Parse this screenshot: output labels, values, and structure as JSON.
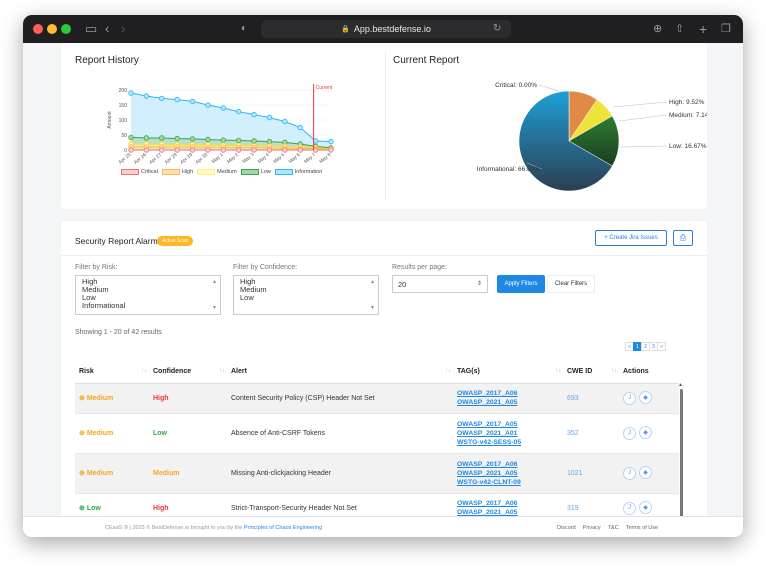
{
  "browser": {
    "url": "App.bestdefense.io"
  },
  "report_history": {
    "title": "Report History",
    "current_label": "Current",
    "legend": [
      "Critical",
      "High",
      "Medium",
      "Low",
      "Information"
    ]
  },
  "current_report": {
    "title": "Current Report",
    "labels": {
      "critical": "Critical: 0.00%",
      "high": "High: 9.52%",
      "medium": "Medium: 7.14%",
      "low": "Low: 16.67%",
      "informational": "Informational: 66.67%"
    }
  },
  "chart_data": [
    {
      "type": "area",
      "title": "Report History",
      "ylabel": "Amount",
      "ylim": [
        0,
        200
      ],
      "yticks": [
        0,
        50,
        100,
        150,
        200
      ],
      "categories": [
        "Apr 25",
        "Apr 26",
        "Apr 27",
        "Apr 28",
        "Apr 29",
        "Apr 30",
        "May 1",
        "May 2",
        "May 3",
        "May 4",
        "May 5",
        "May 6",
        "May 7",
        "May 8"
      ],
      "series": [
        {
          "name": "Critical",
          "values": [
            0,
            0,
            0,
            0,
            0,
            0,
            0,
            0,
            0,
            0,
            0,
            0,
            0,
            0
          ]
        },
        {
          "name": "High",
          "values": [
            10,
            10,
            10,
            10,
            10,
            9,
            9,
            8,
            8,
            7,
            6,
            5,
            4,
            4
          ]
        },
        {
          "name": "Medium",
          "values": [
            20,
            19,
            19,
            18,
            18,
            17,
            16,
            15,
            14,
            13,
            12,
            10,
            8,
            3
          ]
        },
        {
          "name": "Low",
          "values": [
            42,
            40,
            40,
            38,
            37,
            35,
            33,
            32,
            30,
            28,
            25,
            20,
            12,
            7
          ]
        },
        {
          "name": "Information",
          "values": [
            190,
            180,
            172,
            168,
            162,
            150,
            140,
            128,
            118,
            108,
            95,
            75,
            30,
            28
          ]
        }
      ],
      "annotation": "Current"
    },
    {
      "type": "pie",
      "title": "Current Report",
      "categories": [
        "Critical",
        "High",
        "Medium",
        "Low",
        "Informational"
      ],
      "values": [
        0.0,
        9.52,
        7.14,
        16.67,
        66.67
      ]
    }
  ],
  "alarms": {
    "title": "Security Report Alarms",
    "badge": "Active Scan",
    "create_jira": "+ Create Jira Issues",
    "print_icon": "printer-icon"
  },
  "filters": {
    "risk_label": "Filter by Risk:",
    "risk_options": [
      "High",
      "Medium",
      "Low",
      "Informational"
    ],
    "confidence_label": "Filter by Confidence:",
    "confidence_options": [
      "High",
      "Medium",
      "Low"
    ],
    "results_label": "Results per page:",
    "results_value": "20",
    "apply": "Apply Filters",
    "clear": "Clear Filters"
  },
  "results_summary": "Showing 1 - 20 of 42 results",
  "pagination": [
    "«",
    "1",
    "2",
    "3",
    "»"
  ],
  "table": {
    "headers": [
      "Risk",
      "Confidence",
      "Alert",
      "TAG(s)",
      "CWE ID",
      "Actions"
    ],
    "rows": [
      {
        "risk": "Medium",
        "confidence": "High",
        "alert": "Content Security Policy (CSP) Header Not Set",
        "tags": [
          "OWASP_2017_A06",
          "OWASP_2021_A05"
        ],
        "cwe": "693"
      },
      {
        "risk": "Medium",
        "confidence": "Low",
        "alert": "Absence of Anti-CSRF Tokens",
        "tags": [
          "OWASP_2017_A05",
          "OWASP_2021_A01",
          "WSTG-v42-SESS-05"
        ],
        "cwe": "352"
      },
      {
        "risk": "Medium",
        "confidence": "Medium",
        "alert": "Missing Anti-clickjacking Header",
        "tags": [
          "OWASP_2017_A06",
          "OWASP_2021_A05",
          "WSTG-v42-CLNT-09"
        ],
        "cwe": "1021"
      },
      {
        "risk": "Low",
        "confidence": "High",
        "alert": "Strict-Transport-Security Header Not Set",
        "tags": [
          "OWASP_2017_A06",
          "OWASP_2021_A05"
        ],
        "cwe": "319"
      }
    ]
  },
  "footer": {
    "copyright": "CEaaS ® | 2023 © BestDefense.io brought to you by the",
    "copyright_link": "Principles of Chaos Engineering",
    "links": [
      "Discord",
      "Privacy",
      "T&C",
      "Terms of Use"
    ]
  },
  "colors": {
    "accent": "#1e88e5",
    "medium": "#f5a623",
    "low": "#2fa84f",
    "high": "#e53935",
    "badge": "#fbb724"
  }
}
